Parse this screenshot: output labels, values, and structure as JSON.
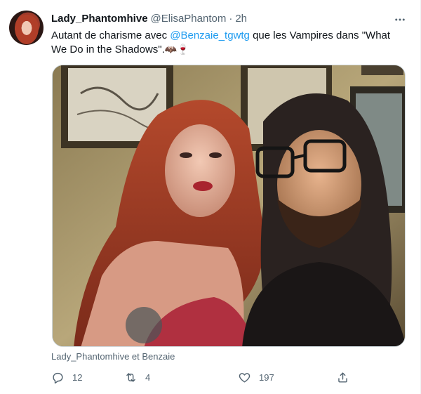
{
  "tweet": {
    "display_name": "Lady_Phantomhive",
    "handle": "@ElisaPhantom",
    "separator": "·",
    "time": "2h",
    "text_before": "Autant de charisme avec ",
    "mention": "@Benzaie_tgwtg",
    "text_after": " que les Vampires dans \"What We Do in the Shadows\".",
    "emojis": "🦇🍷",
    "media_caption": "Lady_Phantomhive et Benzaie",
    "replies": "12",
    "retweets": "4",
    "likes": "197"
  },
  "icons": {
    "avatar": "avatar-photo",
    "more": "more-dots-icon",
    "reply": "reply-bubble-icon",
    "retweet": "retweet-arrows-icon",
    "like": "heart-icon",
    "share": "share-upload-icon"
  },
  "colors": {
    "text": "#0f1419",
    "secondary": "#536471",
    "link": "#1d9bf0",
    "border": "#cfd9de"
  }
}
